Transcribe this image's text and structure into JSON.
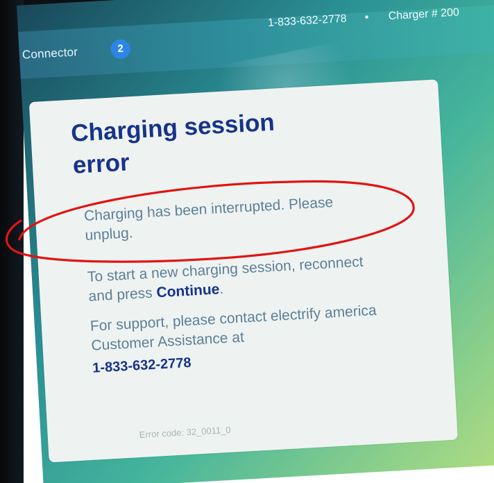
{
  "header": {
    "connector_label": "Connector",
    "connector_number": "2",
    "phone": "1-833-632-2778",
    "separator": "•",
    "charger_label": "Charger # 200"
  },
  "card": {
    "title": "Charging session error",
    "interrupted_message": "Charging has been interrupted. Please unplug.",
    "restart_prefix": "To start a new charging session, reconnect and press ",
    "continue_label": "Continue",
    "restart_suffix": ".",
    "support_text": "For support, please contact electrify america Customer Assistance at",
    "support_phone": "1-833-632-2778",
    "error_code_label": "Error code:",
    "error_code_value": "32_0011_0"
  },
  "colors": {
    "title": "#17338b",
    "body_text": "#5d7f99",
    "connector_badge": "#2c86e8",
    "highlight_circle": "#e11414"
  }
}
